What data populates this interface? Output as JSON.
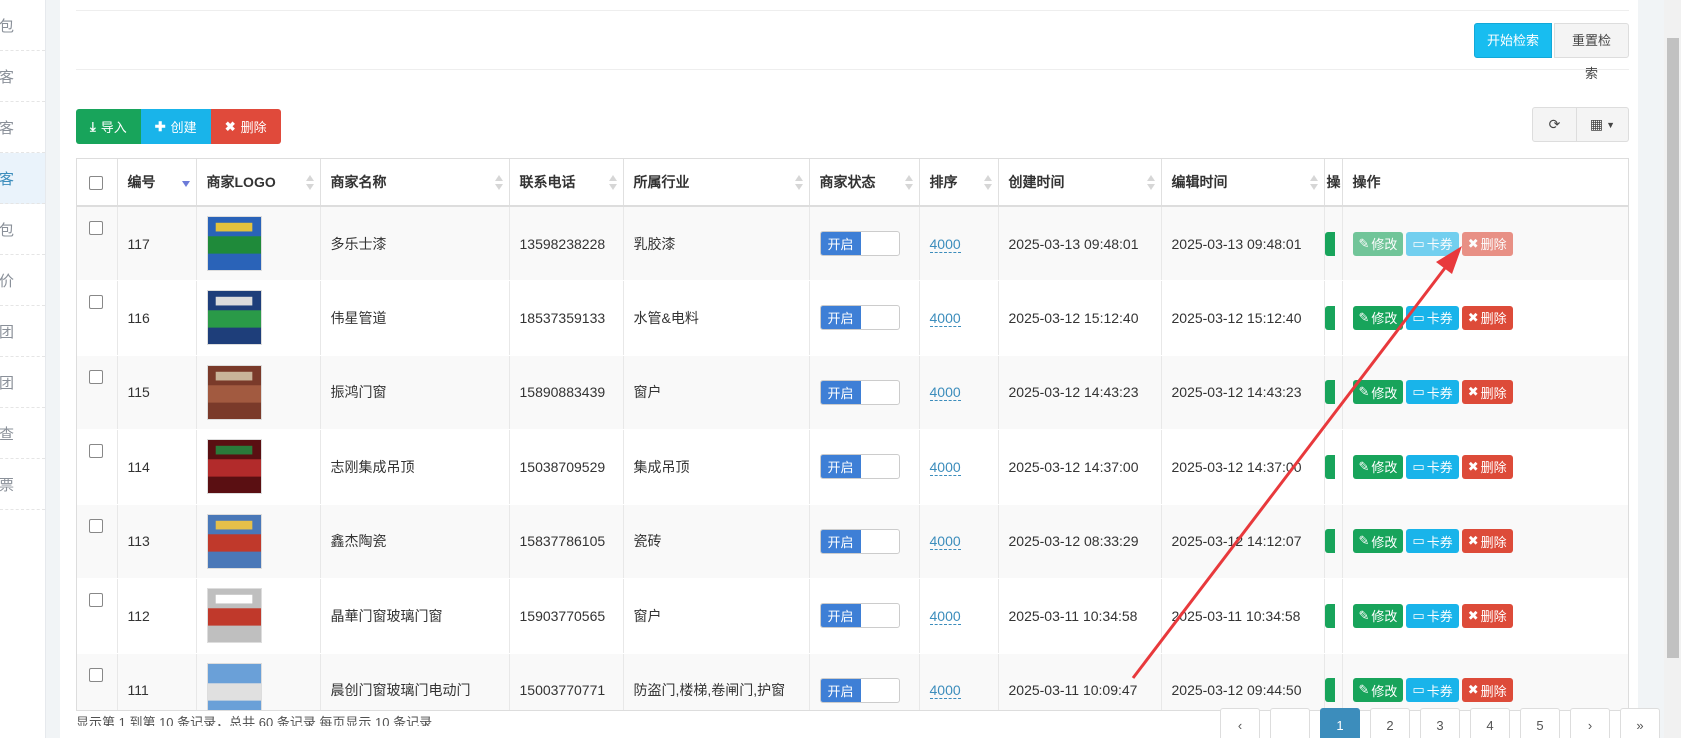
{
  "sidebar": {
    "items": [
      {
        "label": "红包"
      },
      {
        "label": "顾客"
      },
      {
        "label": "商客"
      },
      {
        "label": "商客",
        "active": true
      },
      {
        "label": "红包"
      },
      {
        "label": "评价"
      },
      {
        "label": "拼团"
      },
      {
        "label": "拼团"
      },
      {
        "label": "核查"
      },
      {
        "label": "发票"
      }
    ]
  },
  "search": {
    "start_label": "开始检索",
    "reset_label": "重置检索"
  },
  "toolbar": {
    "import_label": "导入",
    "create_label": "创建",
    "delete_label": "删除"
  },
  "table": {
    "headers": {
      "id": "编号",
      "logo": "商家LOGO",
      "name": "商家名称",
      "phone": "联系电话",
      "industry": "所属行业",
      "status": "商家状态",
      "sort": "排序",
      "created": "创建时间",
      "edited": "编辑时间",
      "hidden_op": "操",
      "ops": "操作"
    },
    "rows": [
      {
        "id": "117",
        "name": "多乐士漆",
        "phone": "13598238228",
        "industry": "乳胶漆",
        "status": "开启",
        "sort": "4000",
        "created": "2025-03-13 09:48:01",
        "edited": "2025-03-13 09:48:01"
      },
      {
        "id": "116",
        "name": "伟星管道",
        "phone": "18537359133",
        "industry": "水管&电料",
        "status": "开启",
        "sort": "4000",
        "created": "2025-03-12 15:12:40",
        "edited": "2025-03-12 15:12:40"
      },
      {
        "id": "115",
        "name": "振鸿门窗",
        "phone": "15890883439",
        "industry": "窗户",
        "status": "开启",
        "sort": "4000",
        "created": "2025-03-12 14:43:23",
        "edited": "2025-03-12 14:43:23"
      },
      {
        "id": "114",
        "name": "志刚集成吊顶",
        "phone": "15038709529",
        "industry": "集成吊顶",
        "status": "开启",
        "sort": "4000",
        "created": "2025-03-12 14:37:00",
        "edited": "2025-03-12 14:37:00"
      },
      {
        "id": "113",
        "name": "鑫杰陶瓷",
        "phone": "15837786105",
        "industry": "瓷砖",
        "status": "开启",
        "sort": "4000",
        "created": "2025-03-12 08:33:29",
        "edited": "2025-03-12 14:12:07"
      },
      {
        "id": "112",
        "name": "晶華门窗玻璃门窗",
        "phone": "15903770565",
        "industry": "窗户",
        "status": "开启",
        "sort": "4000",
        "created": "2025-03-11 10:34:58",
        "edited": "2025-03-11 10:34:58"
      },
      {
        "id": "111",
        "name": "晨创门窗玻璃门电动门",
        "phone": "15003770771",
        "industry": "防盗门,楼梯,卷闸门,护窗",
        "status": "开启",
        "sort": "4000",
        "created": "2025-03-11 10:09:47",
        "edited": "2025-03-12 09:44:50"
      }
    ],
    "op_labels": {
      "edit": "修改",
      "card": "卡券",
      "delete": "删除"
    }
  },
  "pager": {
    "info": "显示第 1 到第 10 条记录，总共 60 条记录 每页显示 10 条记录",
    "pages": [
      "‹",
      "",
      "1",
      "2",
      "3",
      "4",
      "5",
      "›",
      "»"
    ]
  },
  "colors": {
    "accent_blue": "#3c8dbc",
    "success_green": "#18a45b",
    "info_cyan": "#19b4ea",
    "danger_red": "#dd4b39",
    "annotation_arrow": "#e8393c"
  }
}
